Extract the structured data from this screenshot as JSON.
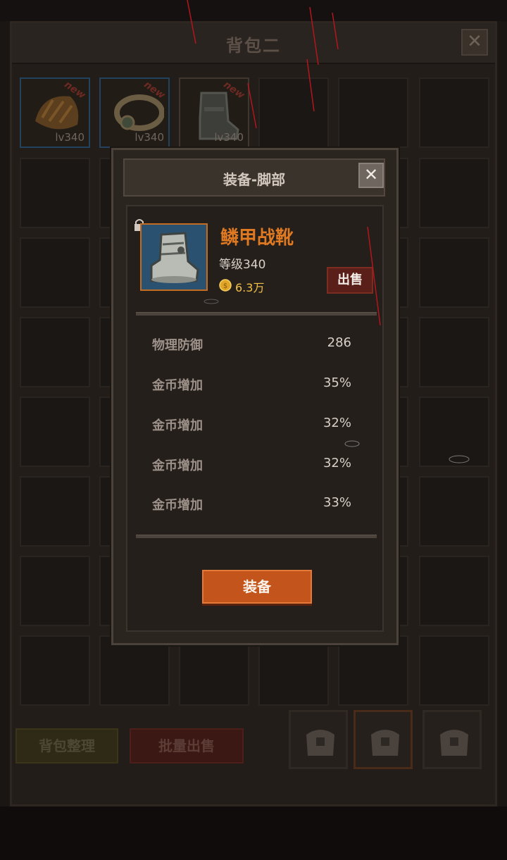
{
  "bag": {
    "title": "背包二",
    "close_label": "✕",
    "items": [
      {
        "level": "lv340",
        "badge": "new"
      },
      {
        "level": "lv340",
        "badge": "new"
      },
      {
        "level": "lv340",
        "badge": "new"
      }
    ],
    "sort_button": "背包整理",
    "batch_sell_button": "批量出售"
  },
  "modal": {
    "title": "装备-脚部",
    "close_label": "✕",
    "item": {
      "name": "鳞甲战靴",
      "level": "等级340",
      "price": "6.3万",
      "icon": "iron-boots-icon"
    },
    "sell_button": "出售",
    "stats": [
      {
        "name": "物理防御",
        "value": "286"
      },
      {
        "name": "金币增加",
        "value": "35%"
      },
      {
        "name": "金币增加",
        "value": "32%"
      },
      {
        "name": "金币增加",
        "value": "32%"
      },
      {
        "name": "金币增加",
        "value": "33%"
      }
    ],
    "equip_button": "装备"
  },
  "colors": {
    "accent_orange": "#c2541c",
    "item_name": "#e07a22",
    "price_gold": "#f2c14a",
    "sell_red": "#5a1f18"
  }
}
